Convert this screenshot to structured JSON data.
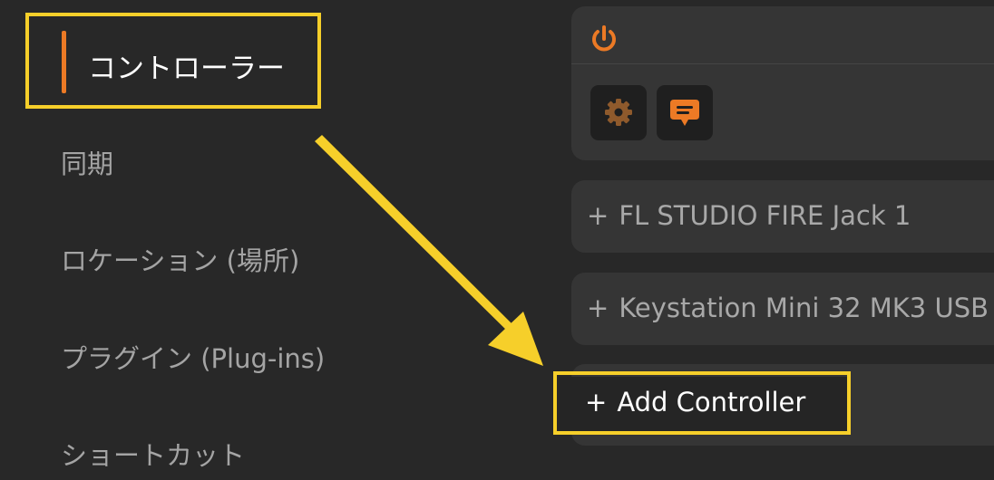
{
  "sidebar": {
    "active": {
      "label": "コントローラー"
    },
    "items": [
      {
        "label": "同期"
      },
      {
        "label": "ロケーション (場所)"
      },
      {
        "label": "プラグイン (Plug-ins)"
      },
      {
        "label": "ショートカット"
      }
    ]
  },
  "controllers": {
    "power_icon": "power-icon",
    "settings_icon": "gear-icon",
    "chat_icon": "speech-bubble-icon",
    "plus_symbol": "+",
    "rows": [
      {
        "label": "FL STUDIO FIRE Jack 1"
      },
      {
        "label": "Keystation Mini 32 MK3 USB"
      }
    ],
    "add_label": "Add Controller"
  },
  "colors": {
    "accent": "#ec7a25",
    "highlight": "#f6cf2a",
    "background": "#282828",
    "panel": "#353535"
  }
}
